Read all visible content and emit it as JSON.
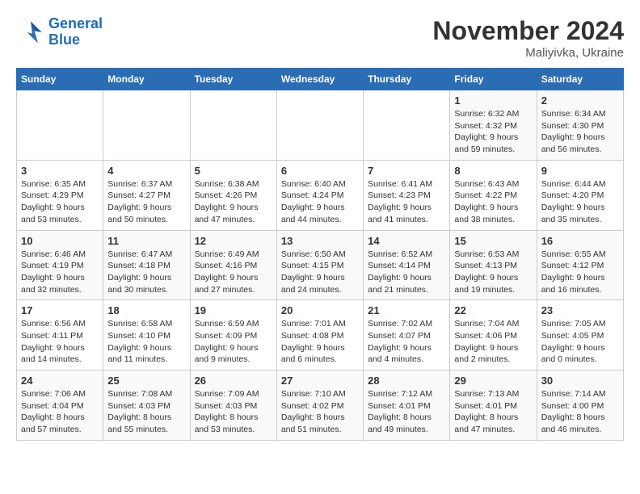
{
  "logo": {
    "line1": "General",
    "line2": "Blue"
  },
  "title": "November 2024",
  "subtitle": "Maliyivka, Ukraine",
  "weekdays": [
    "Sunday",
    "Monday",
    "Tuesday",
    "Wednesday",
    "Thursday",
    "Friday",
    "Saturday"
  ],
  "weeks": [
    [
      {
        "day": "",
        "info": ""
      },
      {
        "day": "",
        "info": ""
      },
      {
        "day": "",
        "info": ""
      },
      {
        "day": "",
        "info": ""
      },
      {
        "day": "",
        "info": ""
      },
      {
        "day": "1",
        "info": "Sunrise: 6:32 AM\nSunset: 4:32 PM\nDaylight: 9 hours and 59 minutes."
      },
      {
        "day": "2",
        "info": "Sunrise: 6:34 AM\nSunset: 4:30 PM\nDaylight: 9 hours and 56 minutes."
      }
    ],
    [
      {
        "day": "3",
        "info": "Sunrise: 6:35 AM\nSunset: 4:29 PM\nDaylight: 9 hours and 53 minutes."
      },
      {
        "day": "4",
        "info": "Sunrise: 6:37 AM\nSunset: 4:27 PM\nDaylight: 9 hours and 50 minutes."
      },
      {
        "day": "5",
        "info": "Sunrise: 6:38 AM\nSunset: 4:26 PM\nDaylight: 9 hours and 47 minutes."
      },
      {
        "day": "6",
        "info": "Sunrise: 6:40 AM\nSunset: 4:24 PM\nDaylight: 9 hours and 44 minutes."
      },
      {
        "day": "7",
        "info": "Sunrise: 6:41 AM\nSunset: 4:23 PM\nDaylight: 9 hours and 41 minutes."
      },
      {
        "day": "8",
        "info": "Sunrise: 6:43 AM\nSunset: 4:22 PM\nDaylight: 9 hours and 38 minutes."
      },
      {
        "day": "9",
        "info": "Sunrise: 6:44 AM\nSunset: 4:20 PM\nDaylight: 9 hours and 35 minutes."
      }
    ],
    [
      {
        "day": "10",
        "info": "Sunrise: 6:46 AM\nSunset: 4:19 PM\nDaylight: 9 hours and 32 minutes."
      },
      {
        "day": "11",
        "info": "Sunrise: 6:47 AM\nSunset: 4:18 PM\nDaylight: 9 hours and 30 minutes."
      },
      {
        "day": "12",
        "info": "Sunrise: 6:49 AM\nSunset: 4:16 PM\nDaylight: 9 hours and 27 minutes."
      },
      {
        "day": "13",
        "info": "Sunrise: 6:50 AM\nSunset: 4:15 PM\nDaylight: 9 hours and 24 minutes."
      },
      {
        "day": "14",
        "info": "Sunrise: 6:52 AM\nSunset: 4:14 PM\nDaylight: 9 hours and 21 minutes."
      },
      {
        "day": "15",
        "info": "Sunrise: 6:53 AM\nSunset: 4:13 PM\nDaylight: 9 hours and 19 minutes."
      },
      {
        "day": "16",
        "info": "Sunrise: 6:55 AM\nSunset: 4:12 PM\nDaylight: 9 hours and 16 minutes."
      }
    ],
    [
      {
        "day": "17",
        "info": "Sunrise: 6:56 AM\nSunset: 4:11 PM\nDaylight: 9 hours and 14 minutes."
      },
      {
        "day": "18",
        "info": "Sunrise: 6:58 AM\nSunset: 4:10 PM\nDaylight: 9 hours and 11 minutes."
      },
      {
        "day": "19",
        "info": "Sunrise: 6:59 AM\nSunset: 4:09 PM\nDaylight: 9 hours and 9 minutes."
      },
      {
        "day": "20",
        "info": "Sunrise: 7:01 AM\nSunset: 4:08 PM\nDaylight: 9 hours and 6 minutes."
      },
      {
        "day": "21",
        "info": "Sunrise: 7:02 AM\nSunset: 4:07 PM\nDaylight: 9 hours and 4 minutes."
      },
      {
        "day": "22",
        "info": "Sunrise: 7:04 AM\nSunset: 4:06 PM\nDaylight: 9 hours and 2 minutes."
      },
      {
        "day": "23",
        "info": "Sunrise: 7:05 AM\nSunset: 4:05 PM\nDaylight: 9 hours and 0 minutes."
      }
    ],
    [
      {
        "day": "24",
        "info": "Sunrise: 7:06 AM\nSunset: 4:04 PM\nDaylight: 8 hours and 57 minutes."
      },
      {
        "day": "25",
        "info": "Sunrise: 7:08 AM\nSunset: 4:03 PM\nDaylight: 8 hours and 55 minutes."
      },
      {
        "day": "26",
        "info": "Sunrise: 7:09 AM\nSunset: 4:03 PM\nDaylight: 8 hours and 53 minutes."
      },
      {
        "day": "27",
        "info": "Sunrise: 7:10 AM\nSunset: 4:02 PM\nDaylight: 8 hours and 51 minutes."
      },
      {
        "day": "28",
        "info": "Sunrise: 7:12 AM\nSunset: 4:01 PM\nDaylight: 8 hours and 49 minutes."
      },
      {
        "day": "29",
        "info": "Sunrise: 7:13 AM\nSunset: 4:01 PM\nDaylight: 8 hours and 47 minutes."
      },
      {
        "day": "30",
        "info": "Sunrise: 7:14 AM\nSunset: 4:00 PM\nDaylight: 8 hours and 46 minutes."
      }
    ]
  ]
}
